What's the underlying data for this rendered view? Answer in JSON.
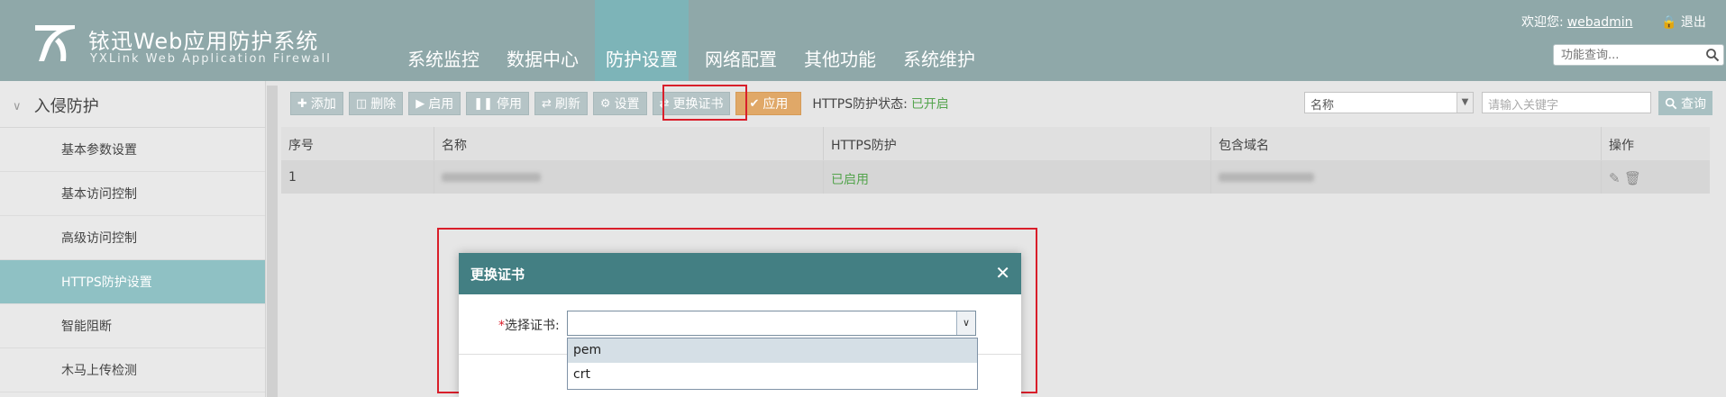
{
  "header": {
    "brand_cn": "铱迅Web应用防护系统",
    "brand_en": "YXLink Web Application Firewall",
    "welcome_label": "欢迎您:",
    "username": "webadmin",
    "logout_label": "退出",
    "search_placeholder": "功能查询...",
    "nav": [
      {
        "label": "系统监控",
        "active": false
      },
      {
        "label": "数据中心",
        "active": false
      },
      {
        "label": "防护设置",
        "active": true
      },
      {
        "label": "网络配置",
        "active": false
      },
      {
        "label": "其他功能",
        "active": false
      },
      {
        "label": "系统维护",
        "active": false
      }
    ]
  },
  "sidebar": {
    "section_title": "入侵防护",
    "items": [
      {
        "label": "基本参数设置",
        "active": false
      },
      {
        "label": "基本访问控制",
        "active": false
      },
      {
        "label": "高级访问控制",
        "active": false
      },
      {
        "label": "HTTPS防护设置",
        "active": true
      },
      {
        "label": "智能阻断",
        "active": false
      },
      {
        "label": "木马上传检测",
        "active": false
      }
    ]
  },
  "toolbar": {
    "add": "添加",
    "delete": "删除",
    "enable": "启用",
    "disable": "停用",
    "refresh": "刷新",
    "settings": "设置",
    "replace_cert": "更换证书",
    "apply": "应用",
    "https_status_label": "HTTPS防护状态:",
    "https_status_value": "已开启",
    "filter_field": "名称",
    "keyword_placeholder": "请输入关键字",
    "query": "查询"
  },
  "table": {
    "headers": [
      "序号",
      "名称",
      "HTTPS防护",
      "包含域名",
      "操作"
    ],
    "rows": [
      {
        "index": "1",
        "https": "已启用"
      }
    ]
  },
  "modal": {
    "title": "更换证书",
    "required_mark": "*",
    "field_label": "选择证书:",
    "options": [
      "pem",
      "crt"
    ]
  },
  "colors": {
    "header_bg": "#8fa8a9",
    "active_nav": "#7db4b8",
    "modal_header": "#437f83",
    "highlight": "#d91e2a",
    "status_green": "#54a44d"
  }
}
